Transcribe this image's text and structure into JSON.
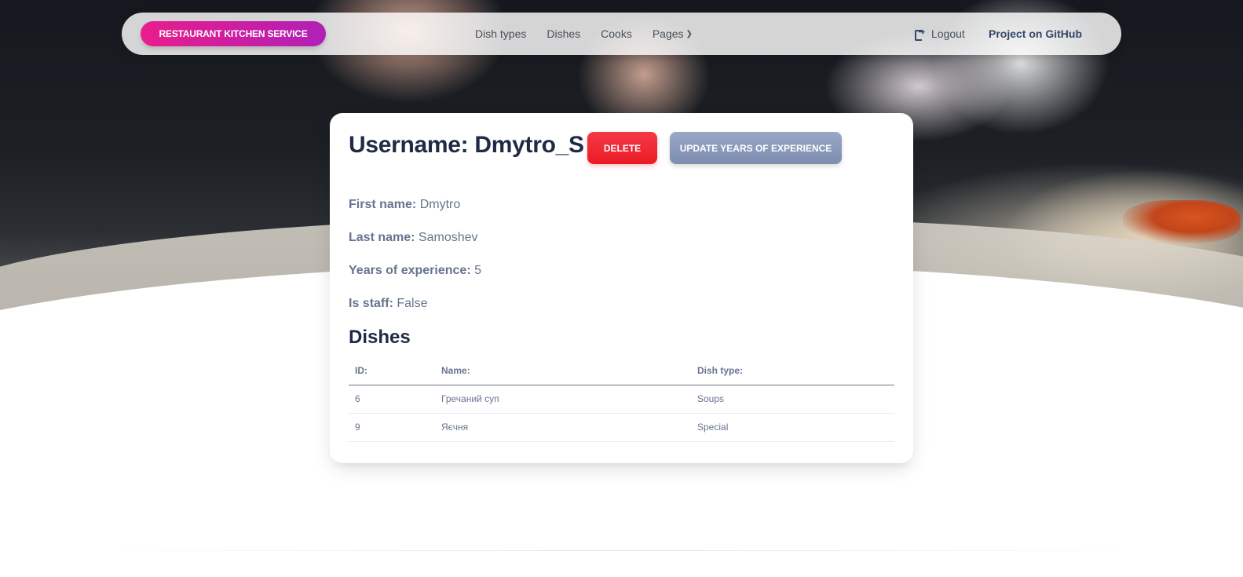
{
  "navbar": {
    "brand": "RESTAURANT KITCHEN SERVICE",
    "links": [
      "Dish types",
      "Dishes",
      "Cooks",
      "Pages"
    ],
    "logout": "Logout",
    "github": "Project on GitHub"
  },
  "cook": {
    "heading": "Username: Dmytro_S",
    "delete_label": "DELETE",
    "update_label": "UPDATE YEARS OF EXPERIENCE",
    "fields": [
      {
        "label": "First name:",
        "value": "Dmytro"
      },
      {
        "label": "Last name:",
        "value": "Samoshev"
      },
      {
        "label": "Years of experience:",
        "value": "5"
      },
      {
        "label": "Is staff:",
        "value": "False"
      }
    ]
  },
  "dishes": {
    "heading": "Dishes",
    "columns": [
      "ID:",
      "Name:",
      "Dish type:"
    ],
    "rows": [
      [
        "6",
        "Гречаний суп",
        "Soups"
      ],
      [
        "9",
        "Яєчня",
        "Special"
      ]
    ]
  },
  "icons": {
    "logout": "logout-icon",
    "pages_dropdown": "chevron-down-icon"
  },
  "colors": {
    "brand_gradient_start": "#e91e8c",
    "brand_gradient_end": "#b11fb7",
    "delete_button": "#ea1b25",
    "update_button": "#8392b5",
    "heading_text": "#1f2a44",
    "body_text": "#67748e"
  }
}
